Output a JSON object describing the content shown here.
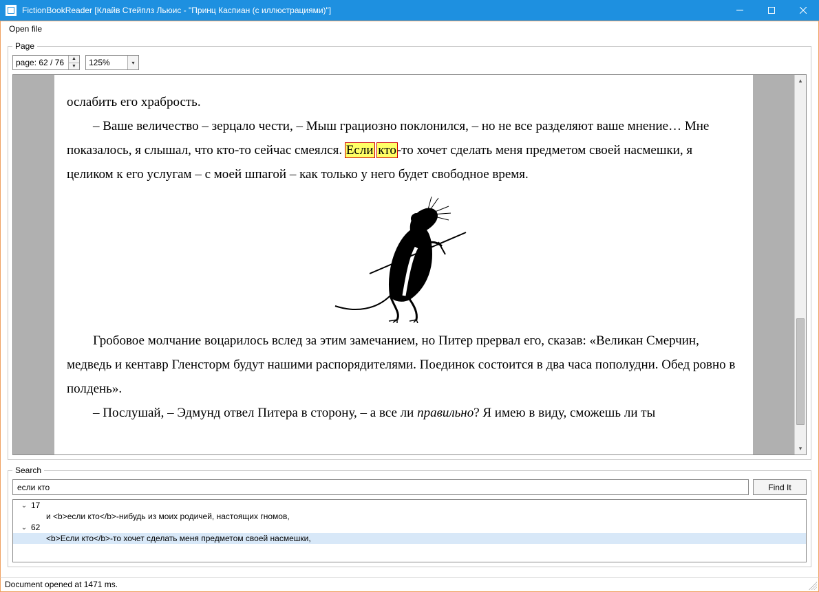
{
  "window": {
    "title": "FictionBookReader [Клайв Стейплз Льюис - \"Принц Каспиан (с иллюстрациями)\"]"
  },
  "menu": {
    "open_file": "Open file"
  },
  "page_group": {
    "legend": "Page",
    "page_spinner_value": "page: 62 / 76",
    "zoom_value": "125%"
  },
  "content": {
    "line1": "ослабить его храбрость.",
    "para2_pre": "– Ваше величество – зерцало чести, – Мыш грациозно поклонился, – но не все разделяют ваше мнение… Мне показалось, я слышал, что кто-то сейчас смеялся. ",
    "hl1": "Если",
    "hl_space": " ",
    "hl2": "кто",
    "para2_post": "-то хочет сделать меня предметом своей насмешки, я целиком к его услугам – с моей шпагой – как только у него будет свободное время.",
    "para3": "Гробовое молчание воцарилось вслед за этим замечанием, но Питер прервал его, сказав: «Великан Смерчин, медведь и кентавр Гленсторм будут нашими распорядителями. Поединок состоится в два часа пополудни. Обед ровно в полдень».",
    "para4_pre": "– Послушай, – Эдмунд отвел Питера в сторону, – а все ли ",
    "para4_em": "правильно",
    "para4_post": "? Я имею в виду, сможешь ли ты"
  },
  "search_group": {
    "legend": "Search",
    "query": "если кто",
    "find_label": "Find It",
    "results": {
      "node1_label": "17",
      "node1_leaf": "и <b>если кто</b>-нибудь из моих родичей, настоящих гномов,",
      "node2_label": "62",
      "node2_leaf": "<b>Если кто</b>-то хочет сделать меня предметом своей насмешки,"
    }
  },
  "status": {
    "text": "Document opened at 1471 ms."
  }
}
